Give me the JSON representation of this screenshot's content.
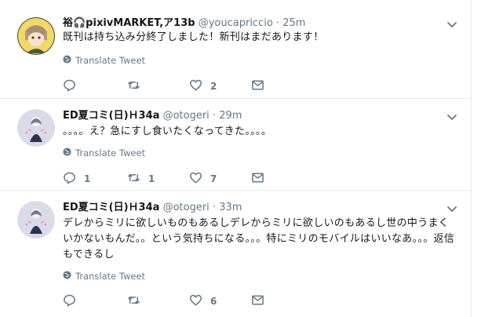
{
  "tweets": [
    {
      "name": "裕🎧pixivMARKET,ア13b",
      "handle": "@youcapriccio",
      "dot": "·",
      "time": "25m",
      "text": "既刊は持ち込み分終了しました！新刊はまだあります！",
      "translate": "Translate Tweet",
      "reply_count": "",
      "retweet_count": "",
      "like_count": "2"
    },
    {
      "name": "ED夏コミ(日)Ｈ34a",
      "handle": "@otogeri",
      "dot": "·",
      "time": "29m",
      "text": "。。。。え？急にすし食いたくなってきた。。。。",
      "translate": "Translate Tweet",
      "reply_count": "1",
      "retweet_count": "1",
      "like_count": "7"
    },
    {
      "name": "ED夏コミ(日)Ｈ34a",
      "handle": "@otogeri",
      "dot": "·",
      "time": "33m",
      "text": "デレからミリに欲しいものもあるしデレからミリに欲しいのもあるし世の中うまくいかないもんだ。。という気持ちになる。。。特にミリのモバイルはいいなあ。。。返信もできるし",
      "translate": "Translate Tweet",
      "reply_count": "",
      "retweet_count": "",
      "like_count": "6"
    }
  ],
  "colors": {
    "secondary_text": "#657786",
    "divider": "#e6ecf0",
    "primary_text": "#14171a"
  }
}
